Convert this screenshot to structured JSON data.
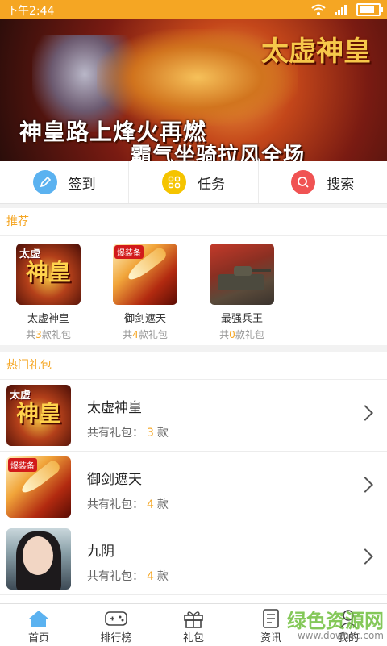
{
  "status": {
    "time": "下午2:44"
  },
  "banner": {
    "logo_text": "太虚神皇",
    "line1": "神皇路上烽火再燃",
    "line2": "霸气坐骑拉风全场"
  },
  "quick_actions": [
    {
      "label": "签到",
      "icon": "pencil-icon",
      "color": "#5bb2f0"
    },
    {
      "label": "任务",
      "icon": "grid-icon",
      "color": "#f5c400"
    },
    {
      "label": "搜索",
      "icon": "search-icon",
      "color": "#f05353"
    }
  ],
  "recommend": {
    "title": "推荐",
    "items": [
      {
        "name": "太虚神皇",
        "prefix": "共",
        "count": "3",
        "suffix": "款礼包"
      },
      {
        "name": "御剑遮天",
        "prefix": "共",
        "count": "4",
        "suffix": "款礼包"
      },
      {
        "name": "最强兵王",
        "prefix": "共",
        "count": "0",
        "suffix": "款礼包"
      }
    ]
  },
  "hot": {
    "title": "热门礼包",
    "items": [
      {
        "name": "太虚神皇",
        "label": "共有礼包：",
        "count": "3",
        "unit": "款"
      },
      {
        "name": "御剑遮天",
        "label": "共有礼包：",
        "count": "4",
        "unit": "款"
      },
      {
        "name": "九阴",
        "label": "共有礼包：",
        "count": "4",
        "unit": "款"
      }
    ]
  },
  "tabs": [
    {
      "label": "首页",
      "icon": "home-icon",
      "active": true
    },
    {
      "label": "排行榜",
      "icon": "gamepad-icon"
    },
    {
      "label": "礼包",
      "icon": "gift-icon"
    },
    {
      "label": "资讯",
      "icon": "news-icon"
    },
    {
      "label": "我的",
      "icon": "user-icon"
    }
  ],
  "watermark": {
    "text": "绿色资源网",
    "sub": "www.downcc.com"
  },
  "colors": {
    "accent": "#f5a623",
    "active_tab": "#5bb2f0"
  }
}
